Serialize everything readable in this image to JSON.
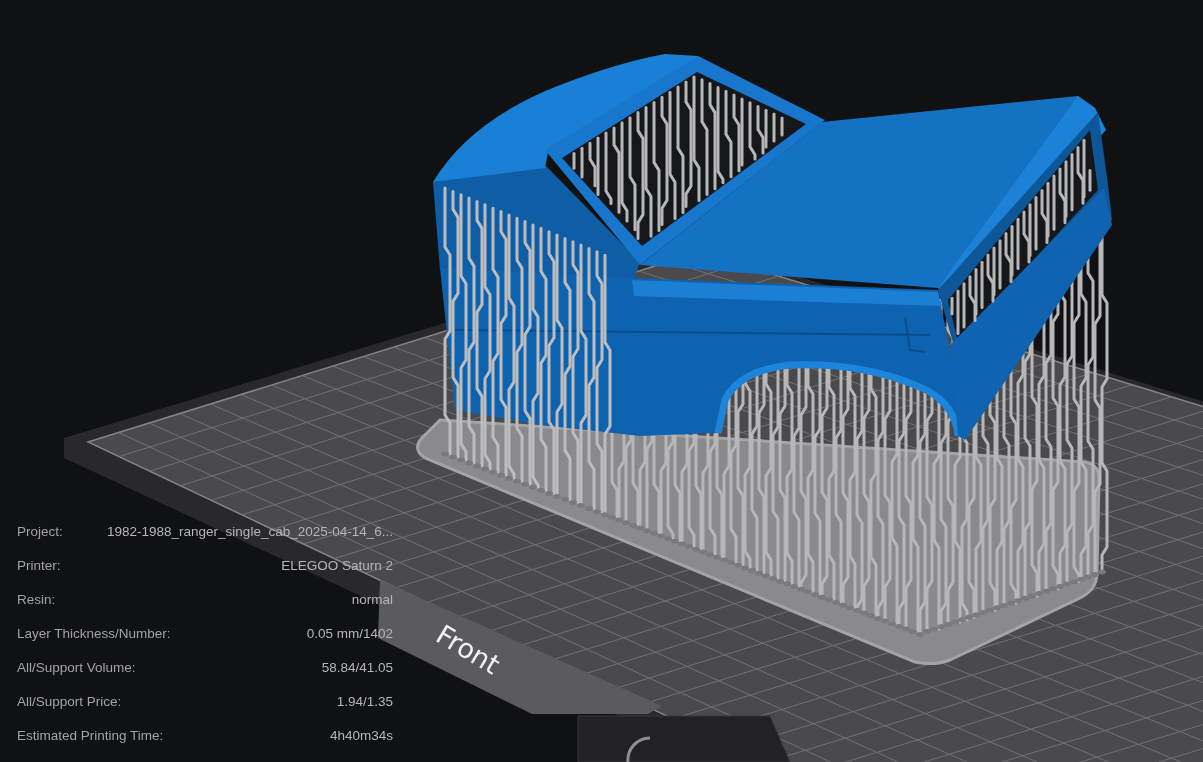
{
  "viewport": {
    "plate_label": "Front"
  },
  "info_panel": {
    "rows": [
      {
        "label": "Project:",
        "value": "1982-1988_ranger_single_cab_2025-04-14_6..."
      },
      {
        "label": "Printer:",
        "value": "ELEGOO Saturn 2"
      },
      {
        "label": "Resin:",
        "value": "normal"
      },
      {
        "label": "Layer Thickness/Number:",
        "value": "0.05 mm/1402"
      },
      {
        "label": "All/Support Volume:",
        "value": "58.84/41.05"
      },
      {
        "label": "All/Support Price:",
        "value": "1.94/1.35"
      },
      {
        "label": "Estimated Printing Time:",
        "value": "4h40m34s"
      }
    ]
  }
}
